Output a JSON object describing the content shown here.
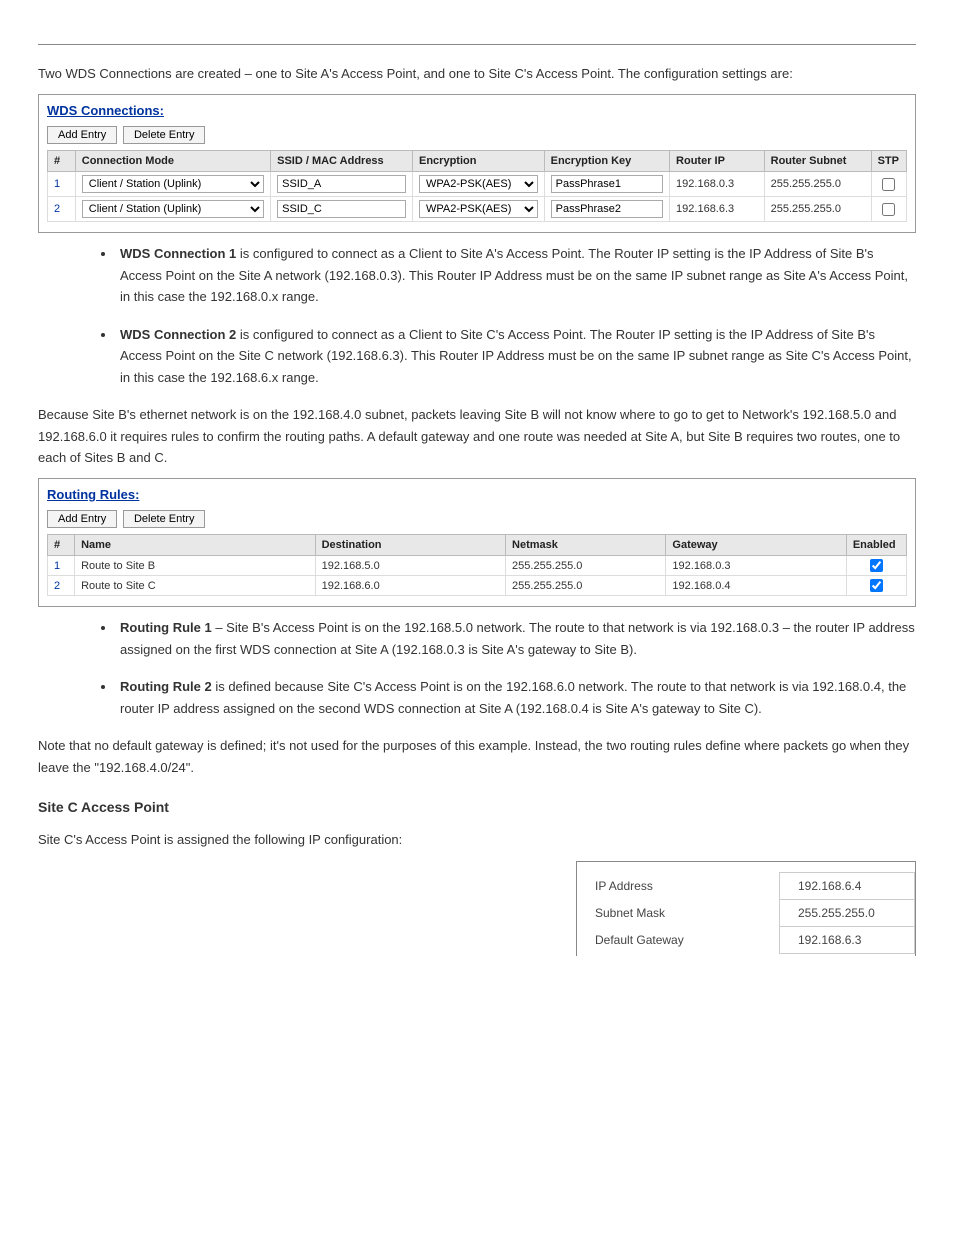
{
  "intro_para": "Two WDS Connections are created – one to Site A's Access Point, and one to Site C's Access Point. The configuration settings are:",
  "wds": {
    "title": "WDS Connections:",
    "add_label": "Add Entry",
    "delete_label": "Delete Entry",
    "headers": {
      "num": "#",
      "mode": "Connection Mode",
      "ssid": "SSID / MAC Address",
      "enc": "Encryption",
      "key": "Encryption Key",
      "rip": "Router IP",
      "rsub": "Router Subnet",
      "stp": "STP"
    },
    "rows": [
      {
        "n": "1",
        "mode": "Client / Station (Uplink)",
        "ssid": "SSID_A",
        "enc": "WPA2-PSK(AES)",
        "key": "PassPhrase1",
        "rip": "192.168.0.3",
        "rsub": "255.255.255.0",
        "stp": false
      },
      {
        "n": "2",
        "mode": "Client / Station (Uplink)",
        "ssid": "SSID_C",
        "enc": "WPA2-PSK(AES)",
        "key": "PassPhrase2",
        "rip": "192.168.6.3",
        "rsub": "255.255.255.0",
        "stp": false
      }
    ]
  },
  "wds_bullets": [
    {
      "head": "WDS Connection 1",
      "body": " is configured to connect as a Client to Site A's Access Point. The Router IP setting is the IP Address of Site B's Access Point on the Site A network (192.168.0.3). This Router IP Address must be on the same IP subnet range as Site A's Access Point, in this case the 192.168.0.x range."
    },
    {
      "head": "WDS Connection 2",
      "body": " is configured to connect as a Client to Site C's Access Point. The Router IP setting is the IP Address of Site B's Access Point on the Site C network (192.168.6.3). This Router IP Address must be on the same IP subnet range as Site C's Access Point, in this case the 192.168.6.x range."
    }
  ],
  "routing_intro": "Because Site B's ethernet network is on the 192.168.4.0 subnet, packets leaving Site B will not know where to go to get to Network's 192.168.5.0 and 192.168.6.0 it requires rules to confirm the routing paths. A default gateway and one route was needed at Site A, but Site B requires two routes, one to each of Sites B and C.",
  "routing": {
    "title": "Routing Rules:",
    "add_label": "Add Entry",
    "delete_label": "Delete Entry",
    "headers": {
      "num": "#",
      "name": "Name",
      "dest": "Destination",
      "mask": "Netmask",
      "gw": "Gateway",
      "en": "Enabled"
    },
    "rows": [
      {
        "n": "1",
        "name": "Route to Site B",
        "dest": "192.168.5.0",
        "mask": "255.255.255.0",
        "gw": "192.168.0.3",
        "en": true
      },
      {
        "n": "2",
        "name": "Route to Site C",
        "dest": "192.168.6.0",
        "mask": "255.255.255.0",
        "gw": "192.168.0.4",
        "en": true
      }
    ]
  },
  "routing_bullets": [
    {
      "head": "Routing Rule 1",
      "body": " – Site B's Access Point is on the 192.168.5.0 network. The route to that network is via 192.168.0.3 – the router IP address assigned on the first WDS connection at Site A (192.168.0.3 is Site A's gateway to Site B)."
    },
    {
      "head": "Routing Rule 2",
      "body": " is defined because Site C's Access Point is on the 192.168.6.0 network. The route to that network is via 192.168.0.4, the router IP address assigned on the second WDS connection at Site A (192.168.0.4 is Site A's gateway to Site C)."
    }
  ],
  "note_para": "Note that no default gateway is defined; it's not used for the purposes of this example. Instead, the two routing rules define where packets go when they leave the \"192.168.4.0/24\".",
  "site_c_heading": "Site C Access Point",
  "site_c_intro": "Site C's Access Point is assigned the following IP configuration:",
  "site_c": {
    "labels": {
      "ip": "IP Address",
      "mask": "Subnet Mask",
      "gw": "Default Gateway"
    },
    "values": {
      "ip": "192.168.6.4",
      "mask": "255.255.255.0",
      "gw": "192.168.6.3"
    }
  }
}
